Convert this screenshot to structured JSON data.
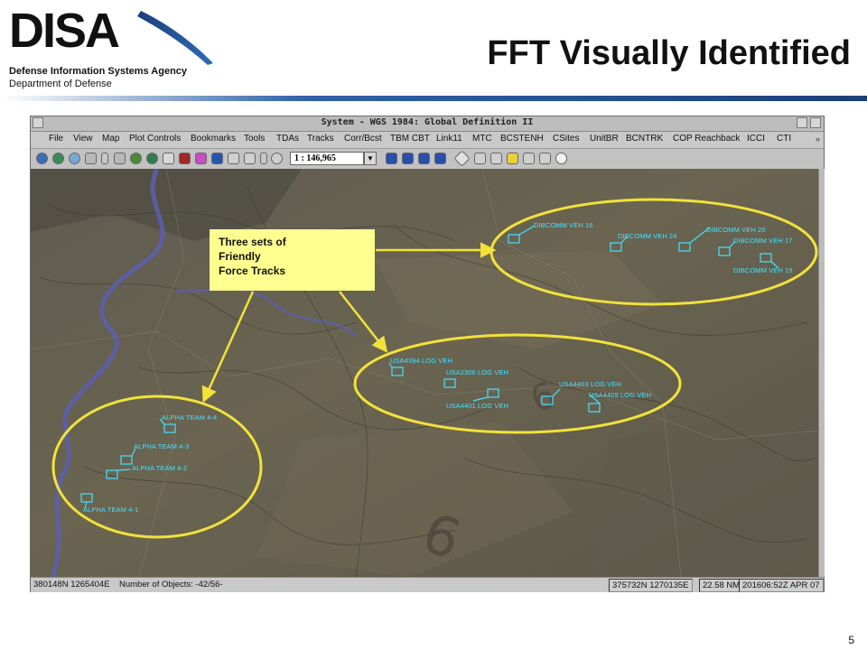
{
  "header": {
    "logo_text": "DISA",
    "agency": "Defense Information Systems Agency",
    "department": "Department of Defense",
    "title": "FFT Visually Identified",
    "page_number": "5"
  },
  "window": {
    "title": "System - WGS 1984: Global Definition II",
    "menus": [
      "File",
      "View",
      "Map",
      "Plot Controls",
      "Bookmarks",
      "Tools",
      "TDAs",
      "Tracks",
      "Corr/Bcst",
      "TBM CBT",
      "Link11",
      "MTC",
      "BCSTENH",
      "CSites",
      "UnitBR",
      "BCNTRK",
      "COP Reachback",
      "ICCI",
      "CTI"
    ],
    "scale": "1 : 146,965"
  },
  "callout": {
    "lines": [
      "Three sets of",
      "Friendly",
      "Force Tracks"
    ]
  },
  "tracks": {
    "group_top_right": [
      "DIBCOMM VEH 16",
      "DIBCOMM VEH 24",
      "DIBCOMM VEH 20",
      "DIBCOMM VEH 17",
      "DIBCOMM VEH 15"
    ],
    "group_center": [
      "USA4394 LOG VEH",
      "USA2306 LOG VEH",
      "USA4401 LOG VEH",
      "USA4403 LOG VEH",
      "USA4409 LOG VEH"
    ],
    "group_left": [
      "ALPHA TEAM 4-4",
      "ALPHA TEAM 4-3",
      "ALPHA TEAM 4-2",
      "ALPHA TEAM 4-1"
    ]
  },
  "status": {
    "position": "380148N 1265404E",
    "objects": "Number of Objects: -42/56-",
    "cursor": "375732N 1270135E",
    "range": "22.58 NM",
    "time": "201606:52Z APR 07"
  },
  "colors": {
    "highlight_ellipse": "#f2e23a",
    "callout_fill": "#ffff8f",
    "track_color": "#45e2ff",
    "river": "#5b5fb0",
    "title_rule": "#2f62a8"
  }
}
